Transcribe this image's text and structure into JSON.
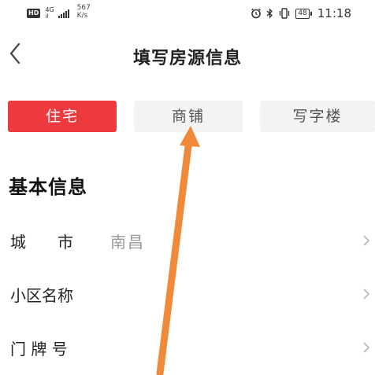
{
  "status_bar": {
    "hd": "HD",
    "net_type_top": "4G",
    "net_type_bottom": "ıl",
    "speed_value": "567",
    "speed_unit": "K/s",
    "battery": "48",
    "time": "11:18"
  },
  "nav": {
    "title": "填写房源信息"
  },
  "tabs": [
    {
      "label": "住宅",
      "active": true
    },
    {
      "label": "商铺",
      "active": false
    },
    {
      "label": "写字楼",
      "active": false
    }
  ],
  "section": {
    "title": "基本信息"
  },
  "form_rows": [
    {
      "label": "城　　市",
      "value": "南昌"
    },
    {
      "label": "小区名称",
      "value": ""
    },
    {
      "label": "门 牌 号",
      "value": ""
    }
  ],
  "colors": {
    "accent": "#ec3a3f",
    "annotation_arrow": "#f08a3a"
  }
}
